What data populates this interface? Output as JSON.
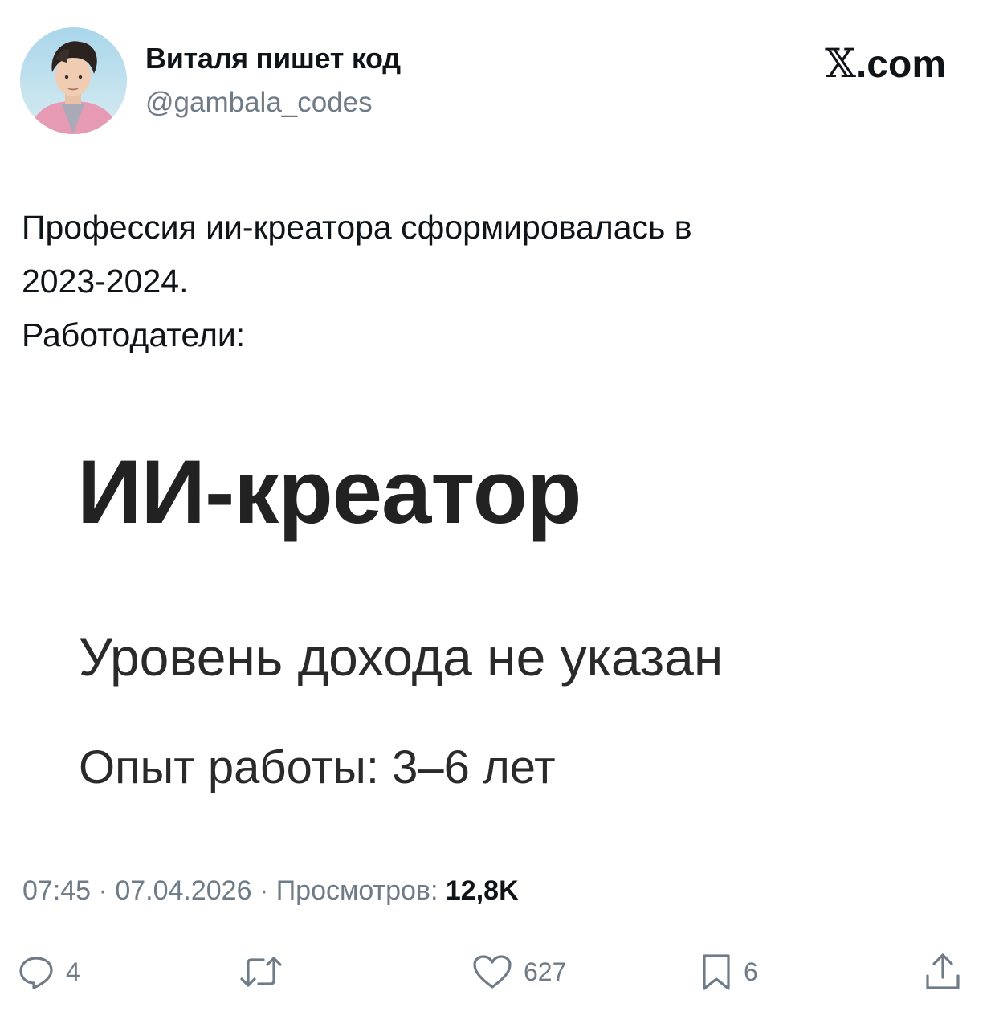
{
  "header": {
    "display_name": "Виталя пишет код",
    "handle": "@gambala_codes",
    "brand": "X.com",
    "brand_x": "𝕏",
    "brand_suffix": ".com"
  },
  "tweet": {
    "lines": [
      "Профессия ии-креатора сформировалась в",
      "2023-2024.",
      "Работодатели:"
    ]
  },
  "media": {
    "title": "ИИ-креатор",
    "line1": "Уровень дохода не указан",
    "line2": "Опыт работы: 3–6 лет"
  },
  "meta": {
    "time": "07:45",
    "separator": "·",
    "date": "07.04.2026",
    "views_label": "Просмотров:",
    "views_count": "12,8K"
  },
  "actions": {
    "replies": "4",
    "retweets": "",
    "likes": "627",
    "bookmarks": "6"
  },
  "icons": {
    "reply": "reply-icon",
    "retweet": "retweet-icon",
    "like": "heart-icon",
    "bookmark": "bookmark-icon",
    "share": "share-icon"
  },
  "colors": {
    "text": "#0f1419",
    "secondary": "#6f7b86",
    "background": "#ffffff"
  }
}
